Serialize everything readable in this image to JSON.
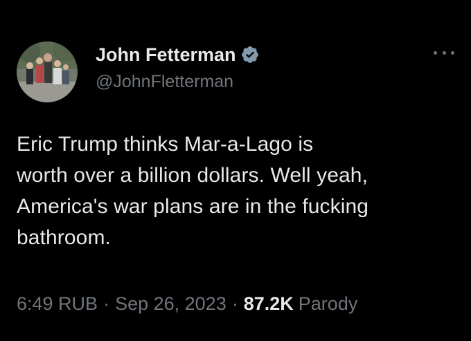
{
  "author": {
    "display_name": "John Fetterman",
    "handle": "@JohnFletterman",
    "verified_icon": "verified-badge-icon",
    "avatar_icon": "avatar-photo"
  },
  "tweet": {
    "text_lines": [
      "Eric Trump thinks Mar-a-Lago is",
      "worth over a billion dollars. Well yeah,",
      "America's war plans are in the fucking",
      "bathroom."
    ]
  },
  "meta": {
    "time": "6:49 RUB",
    "separator": "·",
    "date": "Sep 26, 2023",
    "views_count": "87.2K",
    "views_label": "Parody"
  },
  "menu": {
    "icon": "more-options-icon"
  },
  "colors": {
    "background": "#000000",
    "text": "#e7e9ea",
    "muted": "#71767b",
    "verified": "#829aab"
  }
}
